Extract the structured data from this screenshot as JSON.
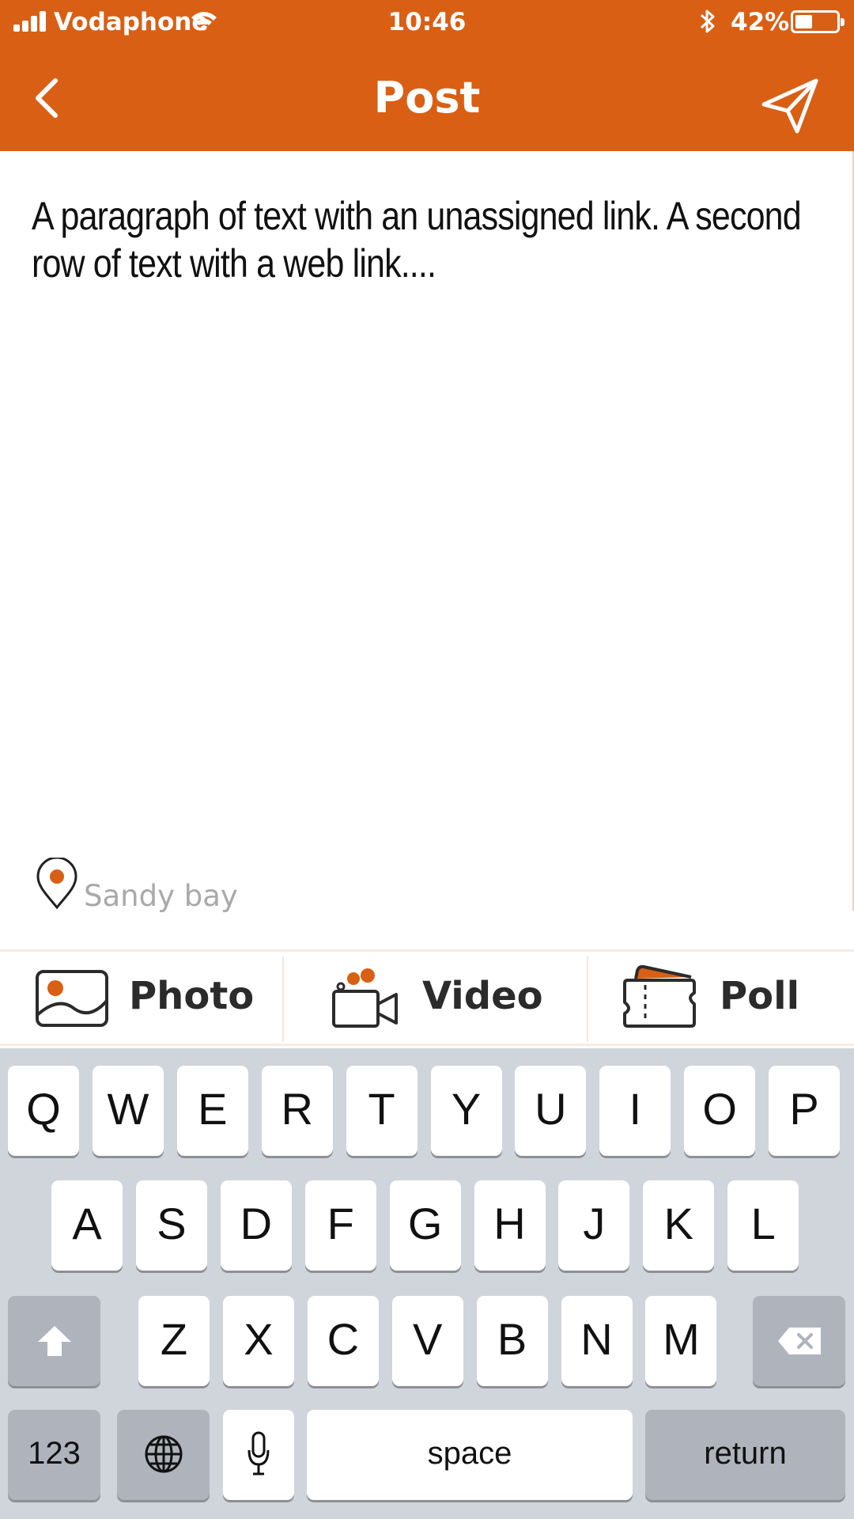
{
  "status_bar": {
    "carrier": "Vodaphone",
    "time": "10:46",
    "battery_percent": "42%",
    "battery_level": 0.42
  },
  "nav": {
    "title": "Post",
    "back_icon": "chevron-left-icon",
    "send_icon": "paper-plane-icon"
  },
  "post": {
    "text": "A paragraph of text with an unassigned link.      A second row of text with a web link...."
  },
  "location": {
    "icon": "map-pin-icon",
    "label": "Sandy bay"
  },
  "attachments": [
    {
      "label": "Photo",
      "icon": "photo-icon"
    },
    {
      "label": "Video",
      "icon": "video-camera-icon"
    },
    {
      "label": "Poll",
      "icon": "ticket-icon"
    }
  ],
  "keyboard": {
    "row1": [
      "Q",
      "W",
      "E",
      "R",
      "T",
      "Y",
      "U",
      "I",
      "O",
      "P"
    ],
    "row2": [
      "A",
      "S",
      "D",
      "F",
      "G",
      "H",
      "J",
      "K",
      "L"
    ],
    "row3": [
      "Z",
      "X",
      "C",
      "V",
      "B",
      "N",
      "M"
    ],
    "numbers_label": "123",
    "space_label": "space",
    "return_label": "return"
  },
  "colors": {
    "accent": "#d95f14",
    "keyboard_bg": "#d0d4db"
  }
}
